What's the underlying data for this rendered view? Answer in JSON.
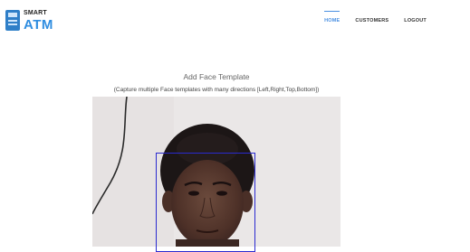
{
  "logo": {
    "small": "SMART",
    "big": "ATM"
  },
  "nav": {
    "items": [
      "HOME",
      "CUSTOMERS",
      "LOGOUT"
    ],
    "active": "HOME"
  },
  "page": {
    "title": "Add Face Template",
    "subtitle": "(Capture multiple Face templates with many directions [Left,Right,Top,Bottom])"
  },
  "colors": {
    "accent": "#4a90e2",
    "brand": "#2f8de0",
    "face_box": "#2a2ad0"
  },
  "icons": [
    "atm-logo-icon"
  ]
}
